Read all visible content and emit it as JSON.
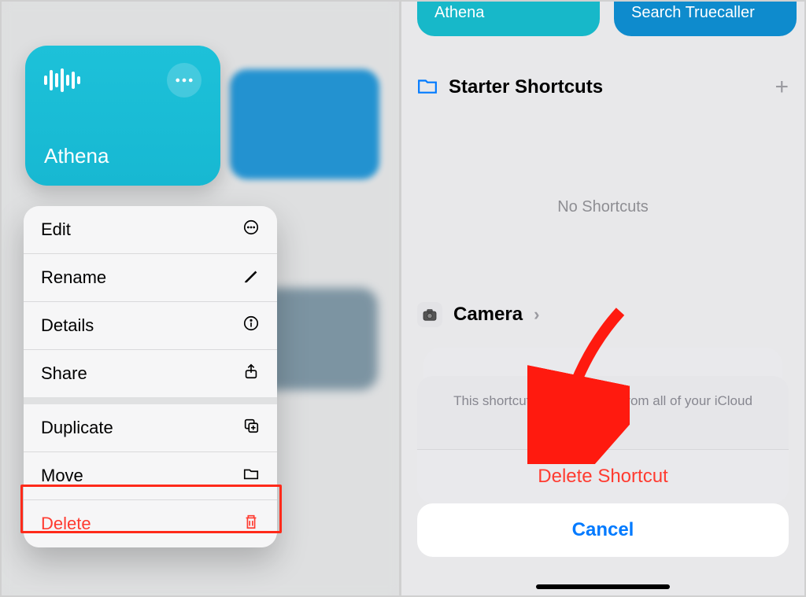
{
  "left": {
    "card_title": "Athena",
    "menu": {
      "edit": "Edit",
      "rename": "Rename",
      "details": "Details",
      "share": "Share",
      "duplicate": "Duplicate",
      "move": "Move",
      "delete": "Delete"
    }
  },
  "right": {
    "chips": {
      "athena": "Athena",
      "truecaller": "Search Truecaller"
    },
    "folder_title": "Starter Shortcuts",
    "empty_label": "No Shortcuts",
    "camera_label": "Camera",
    "sheet_msg": "This shortcut will be deleted from all of your iCloud devices.",
    "delete_action": "Delete Shortcut",
    "cancel": "Cancel"
  }
}
